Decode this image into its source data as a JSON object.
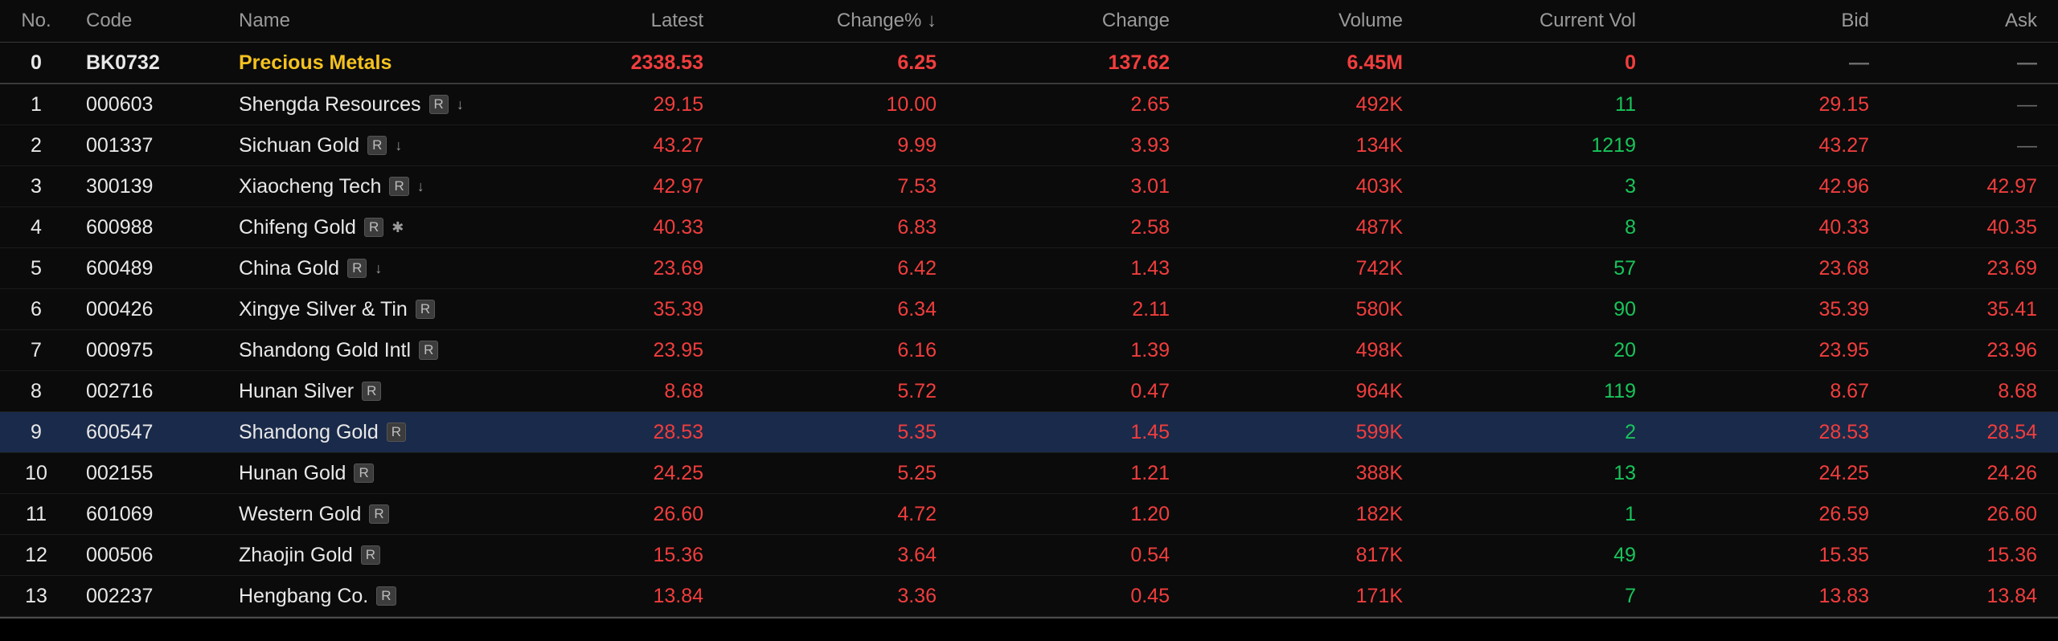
{
  "headers": {
    "no": "No.",
    "code": "Code",
    "name": "Name",
    "latest": "Latest",
    "change_pct": "Change% ↓",
    "change": "Change",
    "volume": "Volume",
    "current_vol": "Current Vol",
    "bid": "Bid",
    "ask": "Ask"
  },
  "group": {
    "no": "0",
    "code": "BK0732",
    "name": "Precious Metals",
    "latest": "2338.53",
    "change_pct": "6.25",
    "change": "137.62",
    "volume": "6.45M",
    "current_vol": "0",
    "bid": "—",
    "ask": "—"
  },
  "rows": [
    {
      "no": "1",
      "code": "000603",
      "name": "Shengda Resources",
      "badge": "R",
      "mark": "↓",
      "latest": "29.15",
      "change_pct": "10.00",
      "change": "2.65",
      "volume": "492K",
      "current_vol": "11",
      "bid": "29.15",
      "ask": "—"
    },
    {
      "no": "2",
      "code": "001337",
      "name": "Sichuan Gold",
      "badge": "R",
      "mark": "↓",
      "latest": "43.27",
      "change_pct": "9.99",
      "change": "3.93",
      "volume": "134K",
      "current_vol": "1219",
      "bid": "43.27",
      "ask": "—"
    },
    {
      "no": "3",
      "code": "300139",
      "name": "Xiaocheng Tech",
      "badge": "R",
      "mark": "↓",
      "latest": "42.97",
      "change_pct": "7.53",
      "change": "3.01",
      "volume": "403K",
      "current_vol": "3",
      "bid": "42.96",
      "ask": "42.97"
    },
    {
      "no": "4",
      "code": "600988",
      "name": "Chifeng Gold",
      "badge": "R",
      "mark": "✱",
      "latest": "40.33",
      "change_pct": "6.83",
      "change": "2.58",
      "volume": "487K",
      "current_vol": "8",
      "bid": "40.33",
      "ask": "40.35"
    },
    {
      "no": "5",
      "code": "600489",
      "name": "China Gold",
      "badge": "R",
      "mark": "↓",
      "latest": "23.69",
      "change_pct": "6.42",
      "change": "1.43",
      "volume": "742K",
      "current_vol": "57",
      "bid": "23.68",
      "ask": "23.69"
    },
    {
      "no": "6",
      "code": "000426",
      "name": "Xingye Silver & Tin",
      "badge": "R",
      "mark": "",
      "latest": "35.39",
      "change_pct": "6.34",
      "change": "2.11",
      "volume": "580K",
      "current_vol": "90",
      "bid": "35.39",
      "ask": "35.41"
    },
    {
      "no": "7",
      "code": "000975",
      "name": "Shandong Gold Intl",
      "badge": "R",
      "mark": "",
      "latest": "23.95",
      "change_pct": "6.16",
      "change": "1.39",
      "volume": "498K",
      "current_vol": "20",
      "bid": "23.95",
      "ask": "23.96"
    },
    {
      "no": "8",
      "code": "002716",
      "name": "Hunan Silver",
      "badge": "R",
      "mark": "",
      "latest": "8.68",
      "change_pct": "5.72",
      "change": "0.47",
      "volume": "964K",
      "current_vol": "119",
      "bid": "8.67",
      "ask": "8.68"
    },
    {
      "no": "9",
      "code": "600547",
      "name": "Shandong Gold",
      "badge": "R",
      "mark": "",
      "latest": "28.53",
      "change_pct": "5.35",
      "change": "1.45",
      "volume": "599K",
      "current_vol": "2",
      "bid": "28.53",
      "ask": "28.54",
      "selected": true
    },
    {
      "no": "10",
      "code": "002155",
      "name": "Hunan Gold",
      "badge": "R",
      "mark": "",
      "latest": "24.25",
      "change_pct": "5.25",
      "change": "1.21",
      "volume": "388K",
      "current_vol": "13",
      "bid": "24.25",
      "ask": "24.26"
    },
    {
      "no": "11",
      "code": "601069",
      "name": "Western Gold",
      "badge": "R",
      "mark": "",
      "latest": "26.60",
      "change_pct": "4.72",
      "change": "1.20",
      "volume": "182K",
      "current_vol": "1",
      "bid": "26.59",
      "ask": "26.60"
    },
    {
      "no": "12",
      "code": "000506",
      "name": "Zhaojin Gold",
      "badge": "R",
      "mark": "",
      "latest": "15.36",
      "change_pct": "3.64",
      "change": "0.54",
      "volume": "817K",
      "current_vol": "49",
      "bid": "15.35",
      "ask": "15.36"
    },
    {
      "no": "13",
      "code": "002237",
      "name": "Hengbang Co.",
      "badge": "R",
      "mark": "",
      "latest": "13.84",
      "change_pct": "3.36",
      "change": "0.45",
      "volume": "171K",
      "current_vol": "7",
      "bid": "13.83",
      "ask": "13.84"
    }
  ],
  "colors": {
    "up": "#f23d3d",
    "volume_tick": "#18c45a",
    "group_name": "#f4c21f",
    "selected_row": "#1a2a4a"
  }
}
